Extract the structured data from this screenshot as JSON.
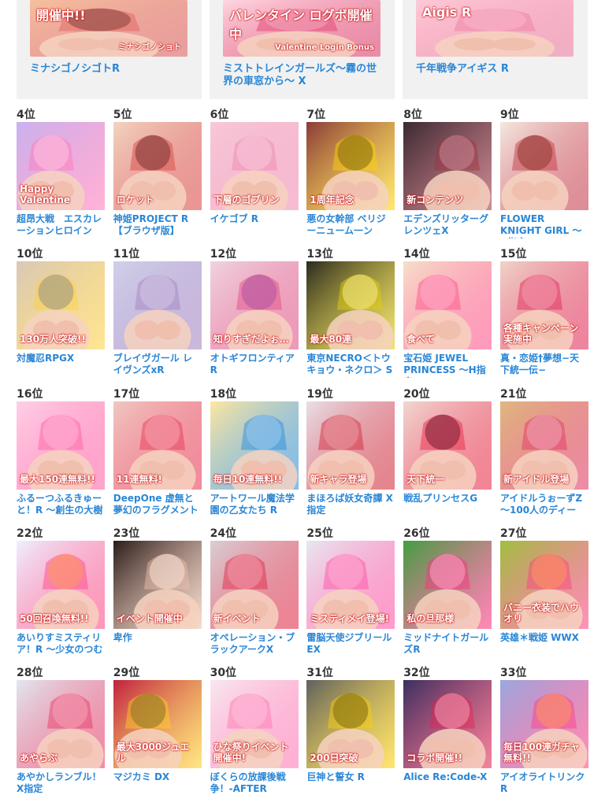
{
  "top": [
    {
      "title": "ミナシゴノシゴトR",
      "banner": "開催中!!",
      "subbanner": "ミナシゴノショト",
      "colors": [
        "#f6c0a0",
        "#e06060",
        "#3a2a20"
      ]
    },
    {
      "title": "ミストトレインガールズ～霧の世界の車窓から～ X",
      "banner": "バレンタイン ログボ開催中",
      "subbanner": "Valentine Login Bonus",
      "colors": [
        "#ffd6e0",
        "#e23a6a",
        "#ffffff"
      ]
    },
    {
      "title": "千年戦争アイギス R",
      "banner": "Aigis R",
      "subbanner": "",
      "colors": [
        "#ffc9d6",
        "#f07aa0",
        "#ffe8ef"
      ]
    }
  ],
  "rows": [
    [
      {
        "rank": "4位",
        "title": "超昂大戦　エスカレーションヒロイン",
        "colors": [
          "#c9b3f0",
          "#ff77b8",
          "#ffffff"
        ],
        "badge": "Happy Valentine"
      },
      {
        "rank": "5位",
        "title": "神姫PROJECT R【ブラウザ版】",
        "colors": [
          "#f2d4c2",
          "#d84040",
          "#2a2a2a"
        ],
        "badge": "ロケット"
      },
      {
        "rank": "6位",
        "title": "イケゴブ R",
        "colors": [
          "#f8c8d8",
          "#ee88b0",
          "#ffffff"
        ],
        "badge": "下層のゴブリン"
      },
      {
        "rank": "7位",
        "title": "悪の女幹部 ベリジーニューム一ン",
        "colors": [
          "#8a3a3a",
          "#ffd200",
          "#1a1a1a"
        ],
        "badge": "1周年記念"
      },
      {
        "rank": "8位",
        "title": "エデンズリッターグレンツェX",
        "colors": [
          "#3a2a32",
          "#a03040",
          "#e0d0d8"
        ],
        "badge": "新コンテンツ"
      },
      {
        "rank": "9位",
        "title": "FLOWER KNIGHT GIRL ～X指定～",
        "colors": [
          "#f4e8e0",
          "#c23040",
          "#6a4020"
        ],
        "badge": ""
      }
    ],
    [
      {
        "rank": "10位",
        "title": "対魔忍RPGX",
        "colors": [
          "#d8c8b8",
          "#ffd040",
          "#4060c0"
        ],
        "badge": "130万人突破!!"
      },
      {
        "rank": "11位",
        "title": "ブレイヴガール レイヴンズxR",
        "colors": [
          "#d0d0ea",
          "#a080c0",
          "#ffffff"
        ],
        "badge": ""
      },
      {
        "rank": "12位",
        "title": "オトギフロンティア R",
        "colors": [
          "#f0d4e0",
          "#e04880",
          "#8a60c0"
        ],
        "badge": "知りすぎだよぉ…"
      },
      {
        "rank": "13位",
        "title": "東京NECRO＜トウキョウ・ネクロ＞ S",
        "colors": [
          "#2a2a20",
          "#e8d000",
          "#ffffff"
        ],
        "badge": "最大80連"
      },
      {
        "rank": "14位",
        "title": "宝石姫 JEWEL PRINCESS ～H指定～",
        "colors": [
          "#f6e0c8",
          "#ff4a88",
          "#ffffff"
        ],
        "badge": "食べて"
      },
      {
        "rank": "15位",
        "title": "真・恋姫†夢想−天下統一伝−",
        "colors": [
          "#f0d4c8",
          "#e02050",
          "#ffffff"
        ],
        "badge": "各種キャンペーン実施中"
      }
    ],
    [
      {
        "rank": "16位",
        "title": "ふるーつふるきゅーと！R ～創生の大樹",
        "colors": [
          "#ffd0e8",
          "#ff5aa0",
          "#ffffff"
        ],
        "badge": "最大150連無料!!"
      },
      {
        "rank": "17位",
        "title": "DeepOne 虚無と夢幻のフラグメント R",
        "colors": [
          "#f0c8c0",
          "#e83050",
          "#ffffff"
        ],
        "badge": "11連無料!"
      },
      {
        "rank": "18位",
        "title": "アートワール魔法学園の乙女たち R",
        "colors": [
          "#ffe8a0",
          "#2088e0",
          "#ffffff"
        ],
        "badge": "毎日10連無料!!"
      },
      {
        "rank": "19位",
        "title": "まほろば妖女奇譚 X指定",
        "colors": [
          "#e8e0e8",
          "#d02030",
          "#ffffff"
        ],
        "badge": "新キャラ登場"
      },
      {
        "rank": "20位",
        "title": "戦乱プリンセスG",
        "colors": [
          "#f0d8d0",
          "#e82040",
          "#1a1a2a"
        ],
        "badge": "天下統一"
      },
      {
        "rank": "21位",
        "title": "アイドルうぉーずZ～100人のディー",
        "colors": [
          "#e0b880",
          "#e03060",
          "#ffffff"
        ],
        "badge": "新アイドル登場"
      }
    ],
    [
      {
        "rank": "22位",
        "title": "あいりすミスティリア！R ～少女のつむ",
        "colors": [
          "#eef0ff",
          "#ff4080",
          "#ffe040"
        ],
        "badge": "50回召喚無料!!"
      },
      {
        "rank": "23位",
        "title": "卑作",
        "colors": [
          "#2a1a18",
          "#f0c0a8",
          "#ffffff"
        ],
        "badge": "イベント開催中"
      },
      {
        "rank": "24位",
        "title": "オペレーション・ブラックアークX",
        "colors": [
          "#d8d0d4",
          "#e02040",
          "#ffffff"
        ],
        "badge": "新イベント"
      },
      {
        "rank": "25位",
        "title": "雷脳天使ジブリールEX",
        "colors": [
          "#e8e8f0",
          "#ff4aa0",
          "#ffffff"
        ],
        "badge": "ミスティメイ登場!"
      },
      {
        "rank": "26位",
        "title": "ミッドナイトガールズR",
        "colors": [
          "#40a040",
          "#ff2a80",
          "#ffffff"
        ],
        "badge": "私の旦那様"
      },
      {
        "rank": "27位",
        "title": "英雄＊戦姫 WWX",
        "colors": [
          "#a0c040",
          "#ff3a80",
          "#ffe040"
        ],
        "badge": "バニー衣装でハウオリ"
      }
    ],
    [
      {
        "rank": "28位",
        "title": "あやかしランブル！X指定",
        "colors": [
          "#e0e8f0",
          "#e83060",
          "#ffffff"
        ],
        "badge": "あやらぶ"
      },
      {
        "rank": "29位",
        "title": "マジカミ DX",
        "colors": [
          "#c02040",
          "#ffd020",
          "#2a2a2a"
        ],
        "badge": "最大3000ジュエル"
      },
      {
        "rank": "30位",
        "title": "ぼくらの放課後戦争！-AFTER SCHO",
        "colors": [
          "#f8e8f0",
          "#ff70b0",
          "#ffffff"
        ],
        "badge": "ひな祭りイベント開催中!"
      },
      {
        "rank": "31位",
        "title": "巨神と誓女 R",
        "colors": [
          "#606060",
          "#ffd000",
          "#1a1a1a"
        ],
        "badge": "200日突破"
      },
      {
        "rank": "32位",
        "title": "Alice Re:Code-X",
        "colors": [
          "#3a3060",
          "#e82050",
          "#ffffff"
        ],
        "badge": "コラボ開催!!"
      },
      {
        "rank": "33位",
        "title": "アイオライトリンク R",
        "colors": [
          "#9aa8e0",
          "#ff3a80",
          "#ffe040"
        ],
        "badge": "毎日100連ガチャ無料!!"
      }
    ]
  ]
}
